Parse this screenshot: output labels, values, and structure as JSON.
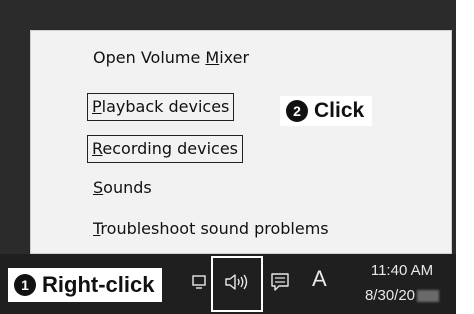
{
  "context_menu": {
    "items": [
      {
        "prefix": "Open Volume ",
        "accel": "M",
        "rest": "ixer"
      },
      {
        "prefix": "",
        "accel": "P",
        "rest": "layback devices"
      },
      {
        "prefix": "",
        "accel": "R",
        "rest": "ecording devices"
      },
      {
        "prefix": "",
        "accel": "S",
        "rest": "ounds"
      },
      {
        "prefix": "",
        "accel": "T",
        "rest": "roubleshoot sound problems"
      }
    ]
  },
  "callouts": {
    "step1_number": "1",
    "step1_label": "Right-click",
    "step2_number": "2",
    "step2_label": "Click"
  },
  "taskbar": {
    "time": "11:40 AM",
    "date": "8/30/20",
    "ime_indicator": "A",
    "icons": [
      "speaker-icon",
      "action-center-icon",
      "network-icon"
    ]
  },
  "colors": {
    "desktop": "#2b2b2b",
    "menu_bg": "#f2f2f2",
    "taskbar": "#1f1f1f",
    "highlight_border": "#222222"
  }
}
